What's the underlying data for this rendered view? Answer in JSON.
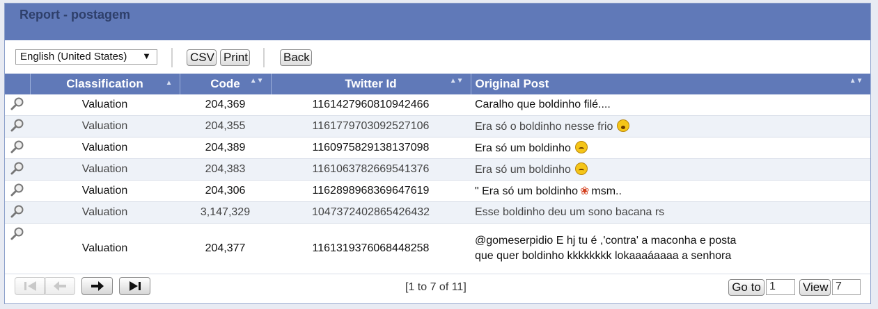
{
  "header": {
    "title": "Report - postagem"
  },
  "toolbar": {
    "language": "English (United States)",
    "caret": "▼",
    "csv_label": "CSV",
    "print_label": "Print",
    "back_label": "Back"
  },
  "table": {
    "columns": [
      "Classification",
      "Code",
      "Twitter Id",
      "Original Post"
    ],
    "sort_asc_glyph": "▲",
    "sort_both_glyph": "▲▼",
    "rows": [
      {
        "classification": "Valuation",
        "code": "204,369",
        "twitter_id": "1161427960810942466",
        "post": "Caralho que boldinho filé....",
        "post_suffix": "",
        "emoji": ""
      },
      {
        "classification": "Valuation",
        "code": "204,355",
        "twitter_id": "1161779703092527106",
        "post": "Era só o boldinho nesse frio",
        "post_suffix": "",
        "emoji": "sleepy-face-emoji"
      },
      {
        "classification": "Valuation",
        "code": "204,389",
        "twitter_id": "1160975829138137098",
        "post": "Era só um boldinho",
        "post_suffix": "",
        "emoji": "weary-face-emoji"
      },
      {
        "classification": "Valuation",
        "code": "204,383",
        "twitter_id": "1161063782669541376",
        "post": "Era só um boldinho",
        "post_suffix": "",
        "emoji": "crying-face-emoji"
      },
      {
        "classification": "Valuation",
        "code": "204,306",
        "twitter_id": "1162898968369647619",
        "post": "\" Era só um boldinho",
        "post_suffix": "msm..",
        "emoji": "maple-leaf-emoji"
      },
      {
        "classification": "Valuation",
        "code": "3,147,329",
        "twitter_id": "1047372402865426432",
        "post": "Esse boldinho deu um sono bacana rs",
        "post_suffix": "",
        "emoji": ""
      },
      {
        "classification": "Valuation",
        "code": "204,377",
        "twitter_id": "1161319376068448258",
        "post": "@gomeserpidio E hj tu é ,'contra' a maconha e posta que quer boldinho kkkkkkkk lokaaaáaaaa a senhora",
        "post_suffix": "",
        "emoji": ""
      }
    ]
  },
  "footer": {
    "page_info": "[1 to 7 of 11]",
    "goto_label": "Go to",
    "goto_value": "1",
    "view_label": "View",
    "view_value": "7"
  },
  "icons": {
    "row_action": "magnifier-icon",
    "nav": [
      "first-page-icon",
      "prev-page-icon",
      "next-page-icon",
      "last-page-icon"
    ]
  },
  "colors": {
    "accent": "#6079b8",
    "alt_row": "#eef2f8"
  }
}
